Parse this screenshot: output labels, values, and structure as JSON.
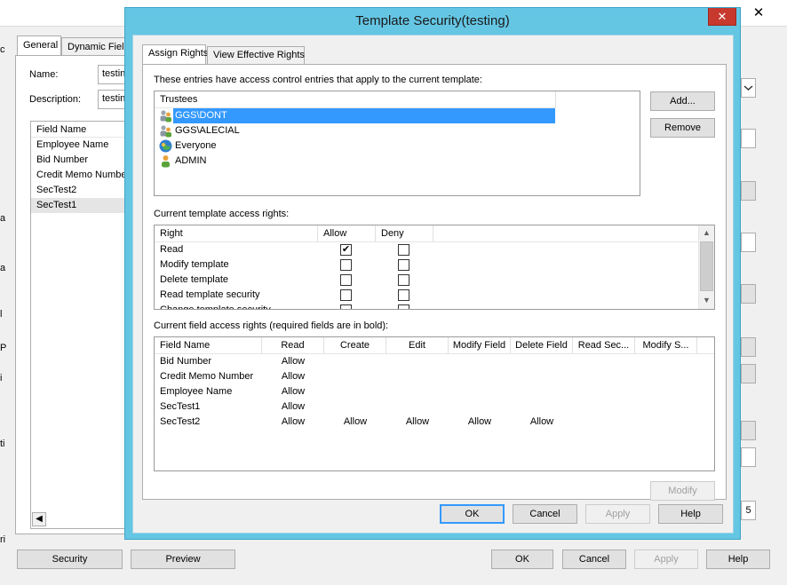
{
  "background_window": {
    "close_glyph": "✕",
    "tabs": [
      "General",
      "Dynamic Field"
    ],
    "name_label": "Name:",
    "name_value": "testin",
    "description_label": "Description:",
    "description_value": "testin",
    "field_list": {
      "header": "Field Name",
      "rows": [
        "Employee Name",
        "Bid Number",
        "Credit Memo Number",
        "SecTest2",
        "SecTest1"
      ]
    },
    "right_partial_value": "5",
    "edge_chars": [
      "c",
      "a",
      "a",
      "l",
      "P",
      "i",
      "ti",
      "ri"
    ],
    "buttons": {
      "security": "Security",
      "preview": "Preview",
      "ok": "OK",
      "cancel": "Cancel",
      "apply": "Apply",
      "help": "Help"
    }
  },
  "dialog": {
    "title": "Template Security(testing)",
    "close_glyph": "✕",
    "tabs": {
      "assign": "Assign Rights",
      "effective": "View Effective Rights"
    },
    "trustees_caption": "These entries have access control entries that apply to the current template:",
    "trustees_header": "Trustees",
    "trustees": [
      {
        "name": "GGS\\DONT",
        "icon": "user-group-icon",
        "selected": true
      },
      {
        "name": "GGS\\ALECIAL",
        "icon": "user-group-icon",
        "selected": false
      },
      {
        "name": "Everyone",
        "icon": "everyone-icon",
        "selected": false
      },
      {
        "name": "ADMIN",
        "icon": "user-icon",
        "selected": false
      }
    ],
    "add_button": "Add...",
    "remove_button": "Remove",
    "template_rights_caption": "Current template access rights:",
    "template_rights_headers": [
      "Right",
      "Allow",
      "Deny"
    ],
    "template_rights": [
      {
        "right": "Read",
        "allow": true,
        "deny": false
      },
      {
        "right": "Modify template",
        "allow": false,
        "deny": false
      },
      {
        "right": "Delete template",
        "allow": false,
        "deny": false
      },
      {
        "right": "Read template security",
        "allow": false,
        "deny": false
      },
      {
        "right": "Change template security",
        "allow": false,
        "deny": false
      }
    ],
    "check_glyph": "✔",
    "scroll_up_glyph": "▲",
    "scroll_down_glyph": "▼",
    "field_rights_caption": "Current field access rights (required fields are in bold):",
    "field_rights_headers": [
      "Field Name",
      "Read",
      "Create",
      "Edit",
      "Modify Field",
      "Delete Field",
      "Read Sec...",
      "Modify S..."
    ],
    "field_rights": [
      [
        "Bid Number",
        "Allow",
        "",
        "",
        "",
        "",
        "",
        ""
      ],
      [
        "Credit Memo Number",
        "Allow",
        "",
        "",
        "",
        "",
        "",
        ""
      ],
      [
        "Employee Name",
        "Allow",
        "",
        "",
        "",
        "",
        "",
        ""
      ],
      [
        "SecTest1",
        "Allow",
        "",
        "",
        "",
        "",
        "",
        ""
      ],
      [
        "SecTest2",
        "Allow",
        "Allow",
        "Allow",
        "Allow",
        "Allow",
        "",
        ""
      ]
    ],
    "modify_button": "Modify",
    "ok_button": "OK",
    "cancel_button": "Cancel",
    "apply_button": "Apply",
    "help_button": "Help"
  }
}
